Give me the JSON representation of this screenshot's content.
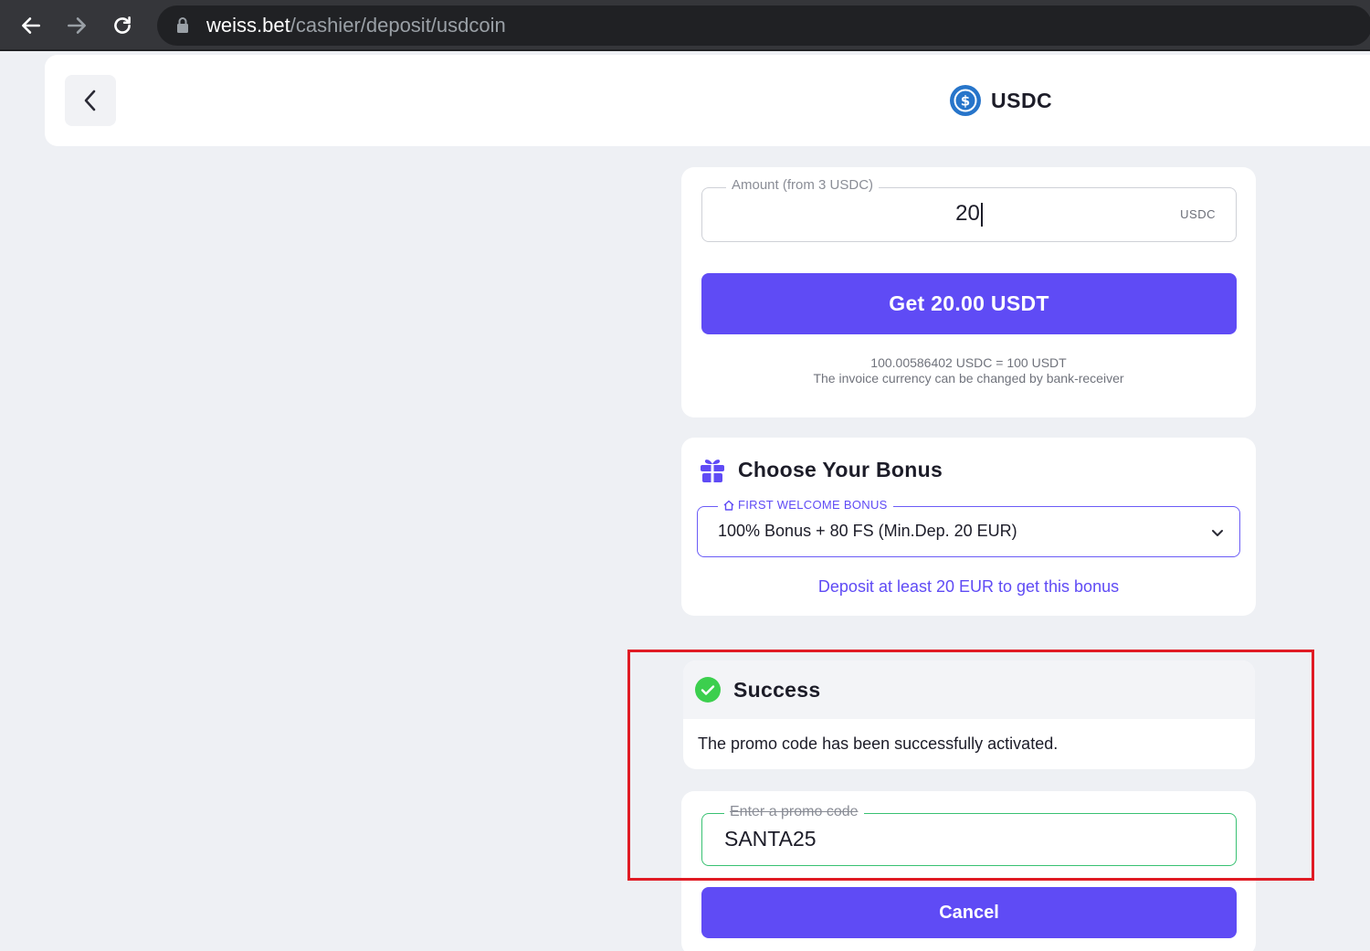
{
  "browser": {
    "url_host": "weiss.bet",
    "url_path": "/cashier/deposit/usdcoin"
  },
  "header": {
    "title": "USDC",
    "coin_icon": "usdc-coin-icon"
  },
  "amount": {
    "label": "Amount (from 3 USDC)",
    "value": "20",
    "unit": "USDC",
    "button_label": "Get 20.00 USDT",
    "rate_text": "100.00586402 USDC = 100 USDT",
    "invoice_note": "The invoice currency can be changed by bank-receiver"
  },
  "bonus": {
    "title": "Choose Your Bonus",
    "select_label": "FIRST WELCOME BONUS",
    "selected_option": "100% Bonus + 80 FS (Min.Dep. 20 EUR)",
    "note": "Deposit at least 20 EUR to get this bonus"
  },
  "success": {
    "title": "Success",
    "message": "The promo code has been successfully activated."
  },
  "promo": {
    "label": "Enter a promo code",
    "value": "SANTA25",
    "cancel_label": "Cancel"
  },
  "colors": {
    "accent": "#5f4bf5",
    "success": "#38c172",
    "highlight": "#e01b24",
    "background": "#eef0f4"
  }
}
